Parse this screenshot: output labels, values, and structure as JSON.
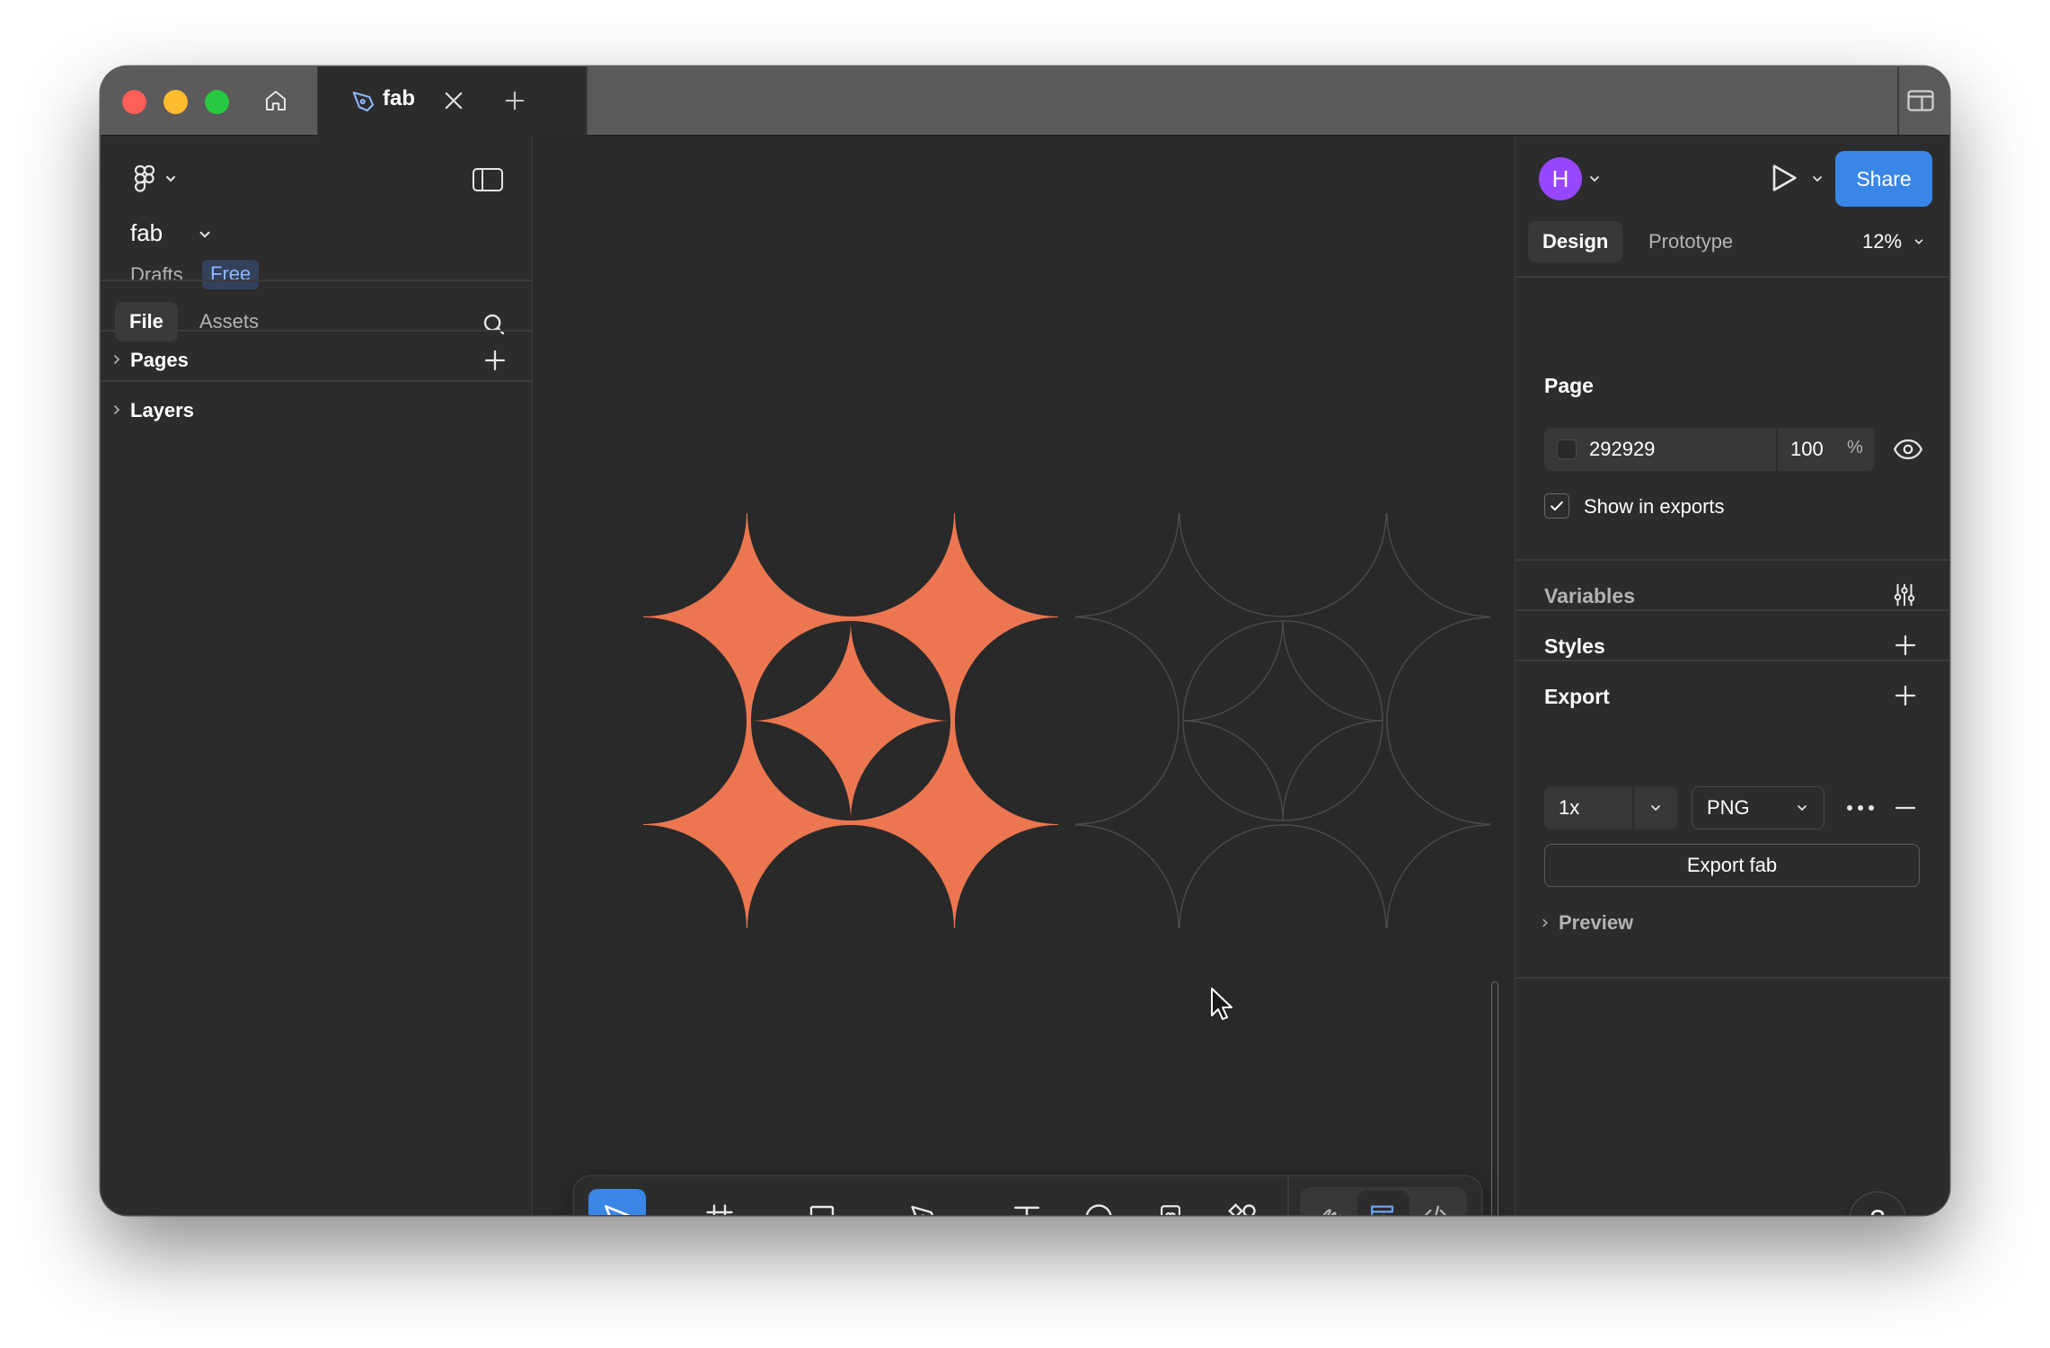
{
  "titlebar": {
    "tab_title": "fab",
    "icons": [
      "home-icon",
      "pen-tool-icon",
      "close-icon",
      "plus-icon",
      "window-icon"
    ]
  },
  "left_panel": {
    "file_name": "fab",
    "location": "Drafts",
    "plan_badge": "Free",
    "tabs": [
      "File",
      "Assets"
    ],
    "sections": {
      "pages": "Pages",
      "layers": "Layers"
    }
  },
  "canvas": {
    "frame_fill": "#292929",
    "accent_shape_color": "#ec7650",
    "outline_color": "#4a4a4a"
  },
  "toolbar": {
    "tools": [
      "move",
      "frame",
      "rectangle",
      "pen",
      "text",
      "comment",
      "actions",
      "components"
    ],
    "active_tool": "move",
    "modes": [
      "draw",
      "design",
      "dev"
    ]
  },
  "right_panel": {
    "avatar_initial": "H",
    "share_label": "Share",
    "tabs": {
      "design": "Design",
      "prototype": "Prototype"
    },
    "zoom": "12%",
    "page": {
      "heading": "Page",
      "fill_hex": "292929",
      "opacity": "100",
      "opacity_unit": "%",
      "show_in_exports": "Show in exports",
      "show_in_exports_checked": true
    },
    "variables": "Variables",
    "styles": "Styles",
    "export": {
      "heading": "Export",
      "scale": "1x",
      "format": "PNG",
      "button": "Export fab",
      "preview": "Preview"
    },
    "help": "?"
  },
  "colors": {
    "accent_blue": "#3a86e6",
    "avatar": "#9747ff",
    "badge_bg": "#33415c",
    "badge_text": "#8fb6ff"
  }
}
